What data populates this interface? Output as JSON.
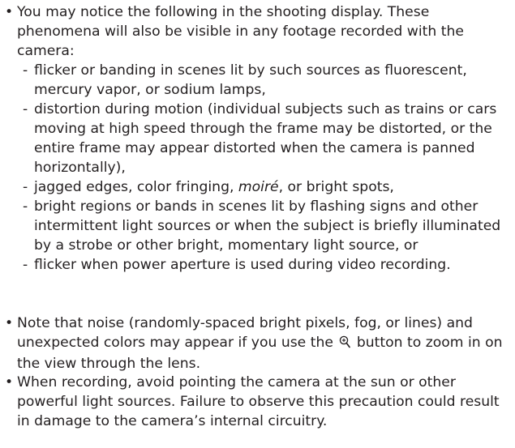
{
  "bullets": [
    {
      "text": "You may notice the following in the shooting display. These phenomena will also be visible in any footage recorded with the camera:",
      "subitems": [
        "flicker or banding in scenes lit by such sources as fluorescent, mercury vapor, or sodium lamps,",
        "distortion during motion (individual subjects such as trains or cars moving at high speed through the frame may be distorted, or the entire frame may appear distorted when the camera is panned horizontally),",
        {
          "before": "jagged edges, color fringing, ",
          "italic": "moiré",
          "after": ", or bright spots,"
        },
        "bright regions or bands in scenes lit by flashing signs and other intermittent light sources or when the subject is briefly illuminated by a strobe or other bright, momentary light source, or",
        "flicker when power aperture is used during video recording."
      ]
    },
    {
      "before": "Note that noise (randomly-spaced bright pixels, fog, or lines) and unexpected colors may appear if you use the",
      "icon": "zoom-in-icon",
      "after": "button to zoom in on the view through the lens."
    },
    {
      "text": "When recording, avoid pointing the camera at the sun or other powerful light sources. Failure to observe this precaution could result in damage to the camera’s internal circuitry."
    }
  ],
  "bullet_glyph": "•",
  "dash_glyph": "-"
}
